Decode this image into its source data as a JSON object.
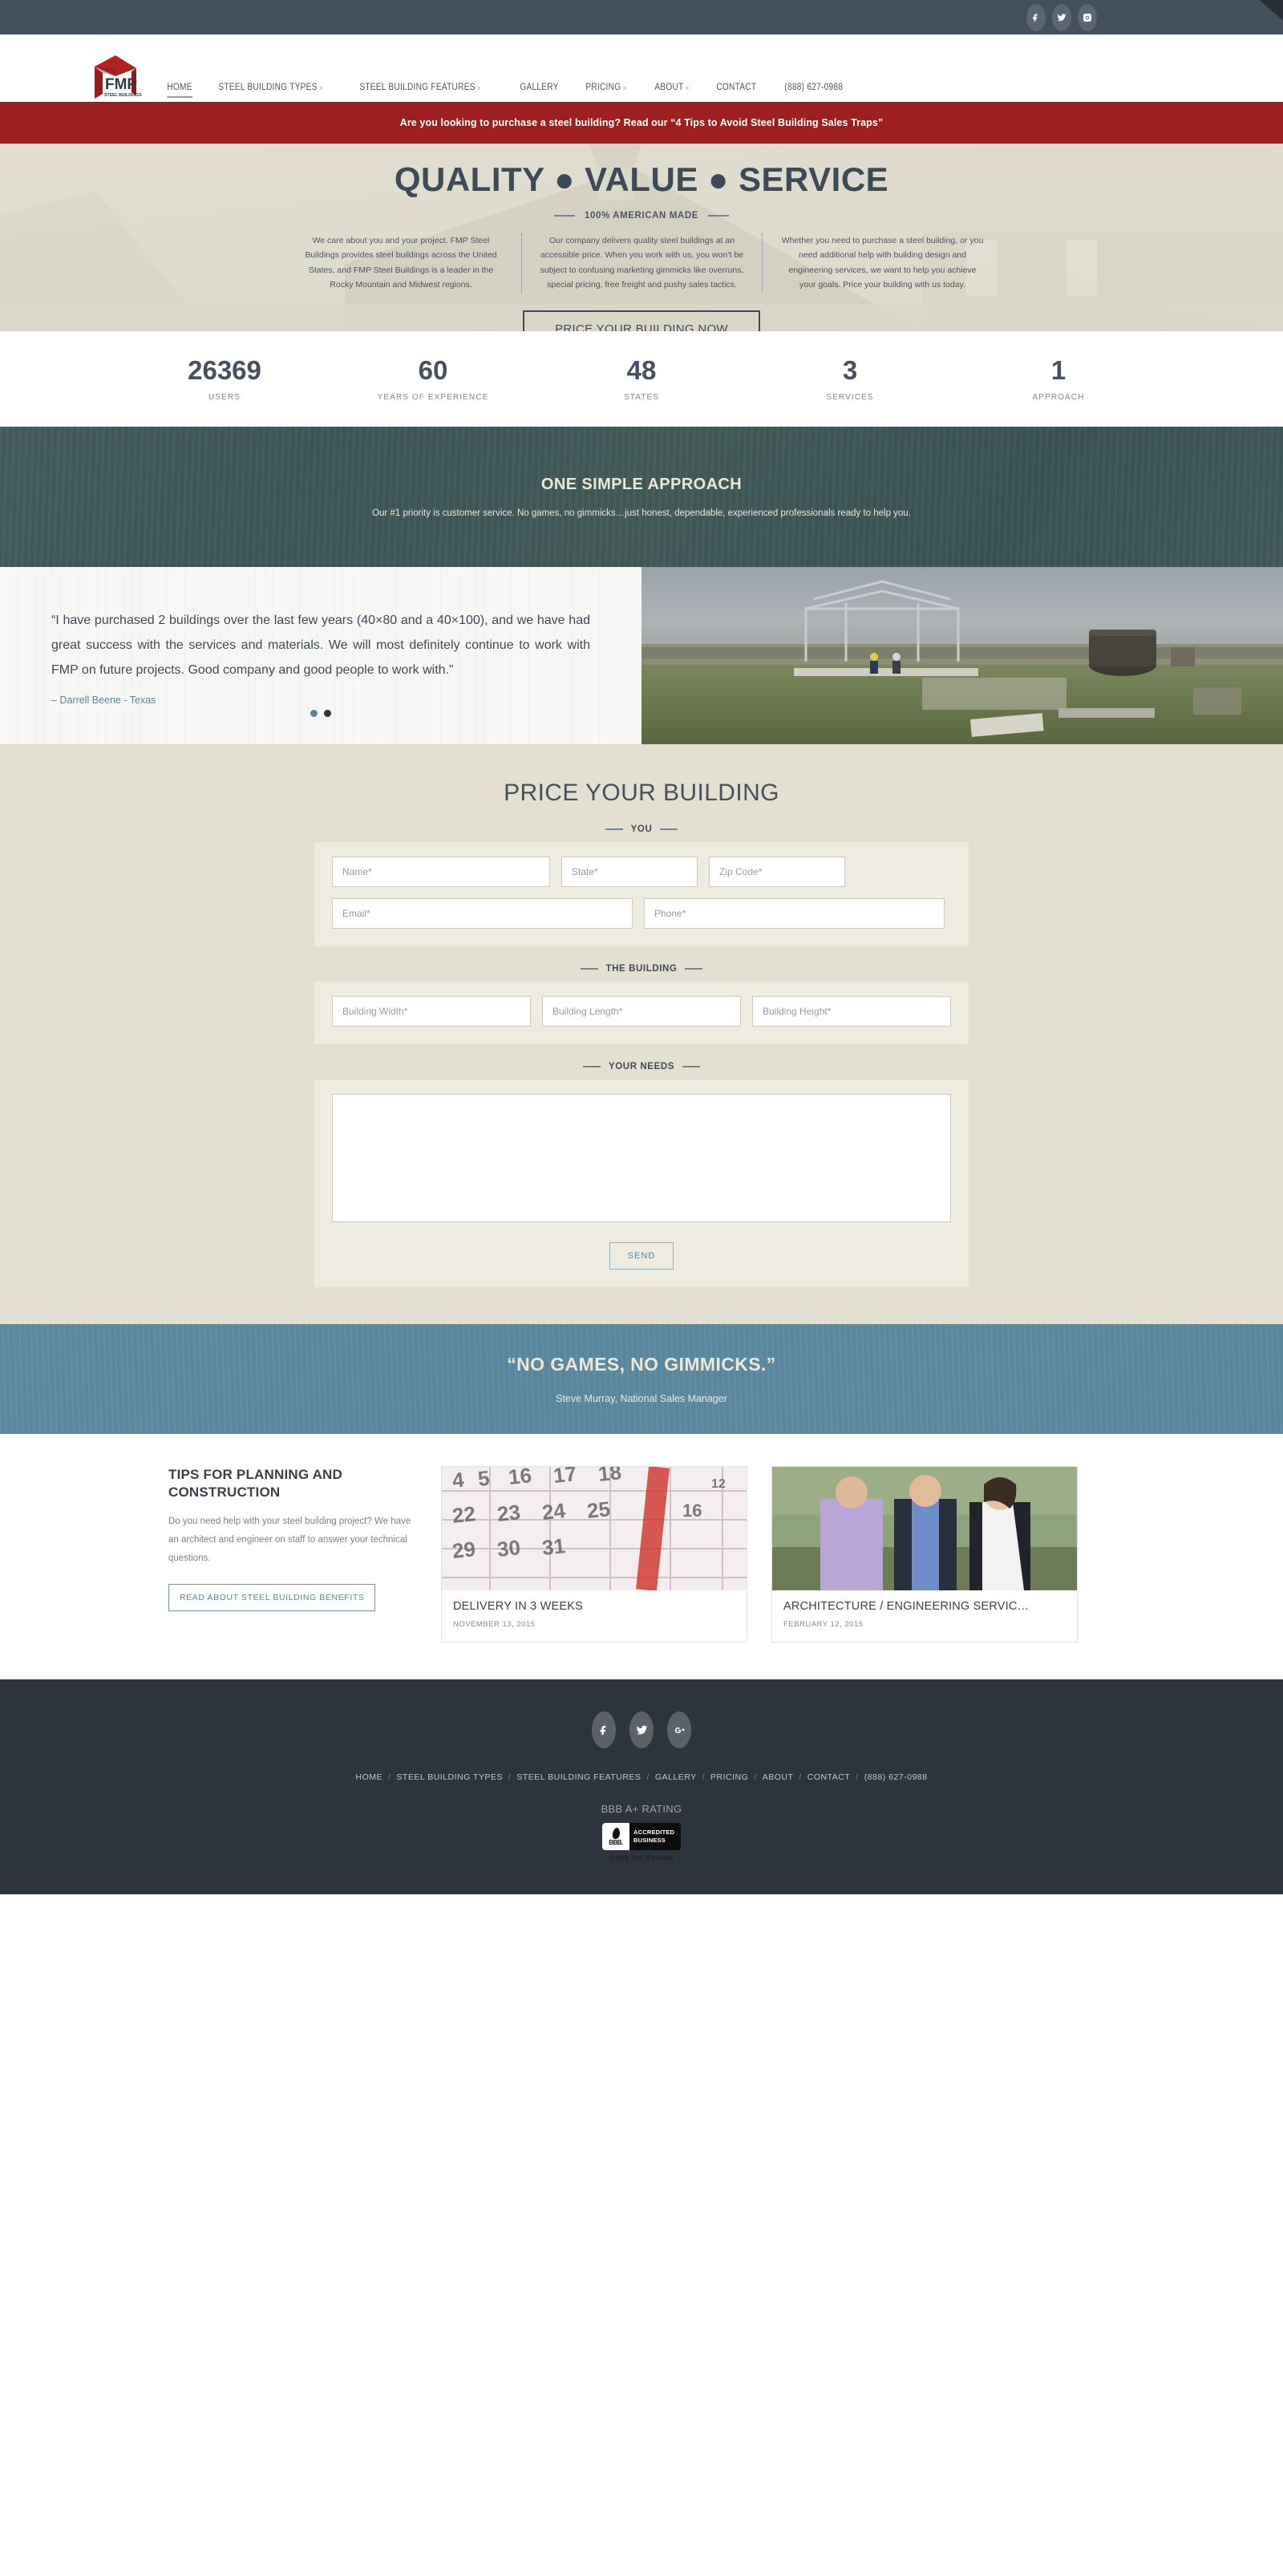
{
  "topbar": {
    "social": [
      {
        "name": "facebook-icon",
        "label": "Facebook"
      },
      {
        "name": "twitter-icon",
        "label": "Twitter"
      },
      {
        "name": "instagram-icon",
        "label": "Instagram"
      }
    ]
  },
  "header": {
    "logo_text_main": "FMP",
    "logo_text_sub": "STEEL BUILDINGS",
    "nav": [
      {
        "label": "HOME",
        "caret": "",
        "active": true
      },
      {
        "label": "STEEL BUILDING TYPES",
        "caret": "»",
        "active": false
      },
      {
        "label": "STEEL BUILDING FEATURES",
        "caret": "»",
        "active": false
      },
      {
        "label": "GALLERY",
        "caret": "",
        "active": false
      },
      {
        "label": "PRICING",
        "caret": "»",
        "active": false
      },
      {
        "label": "ABOUT",
        "caret": "»",
        "active": false
      },
      {
        "label": "CONTACT",
        "caret": "",
        "active": false
      },
      {
        "label": "(888) 627-0988",
        "caret": "",
        "active": false
      }
    ]
  },
  "announcement": {
    "text": "Are you looking to purchase a steel building? Read our “4 Tips to Avoid Steel Building Sales Traps”"
  },
  "hero": {
    "title": "QUALITY ● VALUE ● SERVICE",
    "subtitle": "100% AMERICAN MADE",
    "columns": [
      "We care about you and your project. FMP Steel Buildings provides steel buildings across the United States, and FMP Steel Buildings is a leader in the Rocky Mountain and Midwest regions.",
      "Our company delivers quality steel buildings at an accessible price. When you work with us, you won’t be subject to confusing marketing gimmicks like overruns, special pricing, free freight and pushy sales tactics.",
      "Whether you need to purchase a steel building, or you need additional help with building design and engineering services, we want to help you achieve your goals. Price your building with us today."
    ],
    "cta": "PRICE YOUR BUILDING NOW"
  },
  "stats": [
    {
      "value": "26369",
      "label": "USERS"
    },
    {
      "value": "60",
      "label": "YEARS OF EXPERIENCE"
    },
    {
      "value": "48",
      "label": "STATES"
    },
    {
      "value": "3",
      "label": "SERVICES"
    },
    {
      "value": "1",
      "label": "APPROACH"
    }
  ],
  "approach": {
    "title": "ONE SIMPLE APPROACH",
    "subtitle": "Our #1 priority is customer service. No games, no gimmicks…just honest, dependable, experienced professionals ready to help you."
  },
  "testimonial": {
    "quote": "“I have purchased 2 buildings over the last few years (40×80 and a 40×100), and we have had great success with the services and materials. We will most definitely continue to work with FMP on future projects. Good company and good people to work with.”",
    "author": "– Darrell Beene - Texas",
    "slide_count": 2,
    "active_slide": 2
  },
  "form": {
    "title": "PRICE YOUR BUILDING",
    "groups": [
      {
        "label": "YOU"
      },
      {
        "label": "THE BUILDING"
      },
      {
        "label": "YOUR NEEDS"
      }
    ],
    "fields": {
      "name": "Name*",
      "state": "State*",
      "zip": "Zip Code*",
      "email": "Email*",
      "phone": "Phone*",
      "width": "Building Width*",
      "length": "Building Length*",
      "height": "Building Height*",
      "needs": ""
    },
    "submit": "SEND"
  },
  "bluequote": {
    "title": "“NO GAMES, NO GIMMICKS.”",
    "attribution": "Steve Murray, National Sales Manager"
  },
  "tips": {
    "heading": "TIPS FOR PLANNING AND CONSTRUCTION",
    "paragraph": "Do you need help with your steel building project? We have an architect and engineer on staff to answer your technical questions.",
    "button": "READ ABOUT STEEL BUILDING BENEFITS",
    "cards": [
      {
        "title": "DELIVERY IN 3 WEEKS",
        "date": "NOVEMBER 13, 2015",
        "image": "calendar-photo"
      },
      {
        "title": "ARCHITECTURE / ENGINEERING SERVIC…",
        "date": "FEBRUARY 12, 2015",
        "image": "team-photo"
      }
    ]
  },
  "footer": {
    "social": [
      {
        "name": "facebook-icon",
        "label": "Facebook"
      },
      {
        "name": "twitter-icon",
        "label": "Twitter"
      },
      {
        "name": "google-plus-icon",
        "label": "Google Plus"
      }
    ],
    "links": [
      "HOME",
      "STEEL BUILDING TYPES",
      "STEEL BUILDING FEATURES",
      "GALLERY",
      "PRICING",
      "ABOUT",
      "CONTACT",
      "(888) 627-0988"
    ],
    "separator": "/",
    "bbb_title": "BBB A+ RATING",
    "bbb_badge_line1": "ACCREDITED",
    "bbb_badge_line2": "BUSINESS",
    "bbb_letters": "BBB.",
    "bbb_click": "Click for Review"
  },
  "colors": {
    "topbar": "#434f5c",
    "red": "#9e1f1f",
    "dark": "#2e343d",
    "accent_blue": "#5f8496",
    "cream": "#e3e0d2"
  }
}
